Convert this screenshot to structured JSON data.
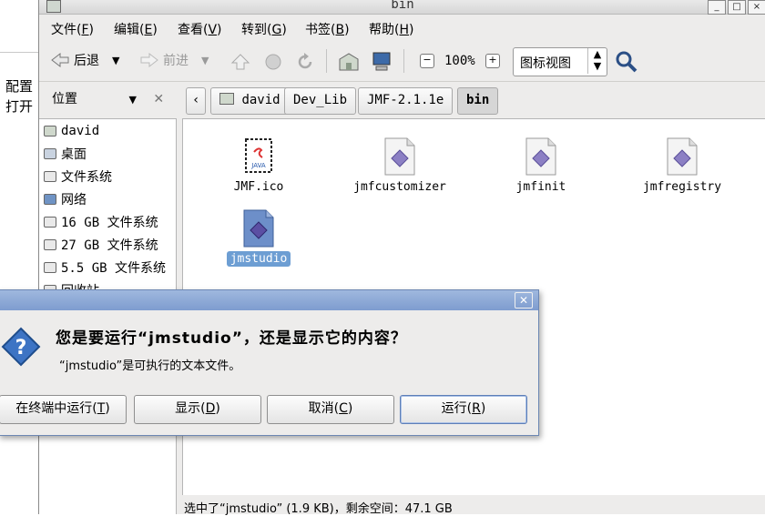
{
  "background_window": {
    "labels": [
      "配置",
      "打开"
    ]
  },
  "window": {
    "title": "bin"
  },
  "menubar": {
    "items": [
      {
        "label": "文件(",
        "key": "F",
        "end": ")"
      },
      {
        "label": "编辑(",
        "key": "E",
        "end": ")"
      },
      {
        "label": "查看(",
        "key": "V",
        "end": ")"
      },
      {
        "label": "转到(",
        "key": "G",
        "end": ")"
      },
      {
        "label": "书签(",
        "key": "B",
        "end": ")"
      },
      {
        "label": "帮助(",
        "key": "H",
        "end": ")"
      }
    ]
  },
  "toolbar": {
    "back_label": "后退",
    "forward_label": "前进",
    "zoom_level": "100%",
    "view_mode": "图标视图"
  },
  "location": {
    "places_label": "位置",
    "crumbs": [
      "david",
      "Dev_Lib",
      "JMF-2.1.1e",
      "bin"
    ]
  },
  "sidebar": {
    "items": [
      "david",
      "桌面",
      "文件系统",
      "网络",
      "16 GB 文件系统",
      "27 GB 文件系统",
      "5.5 GB 文件系统",
      "回收站"
    ]
  },
  "files": [
    {
      "name": "JMF.ico",
      "icon": "java-icon"
    },
    {
      "name": "jmfcustomizer",
      "icon": "executable-icon"
    },
    {
      "name": "jmfinit",
      "icon": "executable-icon"
    },
    {
      "name": "jmfregistry",
      "icon": "executable-icon"
    },
    {
      "name": "jmstudio",
      "icon": "executable-icon",
      "selected": true
    }
  ],
  "status": {
    "text": "选中了“jmstudio” (1.9 KB)，剩余空间：47.1 GB"
  },
  "dialog": {
    "heading": "您是要运行“jmstudio”，还是显示它的内容？",
    "message": "“jmstudio”是可执行的文本文件。",
    "buttons": {
      "terminal": {
        "label": "在终端中运行(",
        "key": "T",
        "end": ")"
      },
      "display": {
        "label": "显示(",
        "key": "D",
        "end": ")"
      },
      "cancel": {
        "label": "取消(",
        "key": "C",
        "end": ")"
      },
      "run": {
        "label": "运行(",
        "key": "R",
        "end": ")"
      }
    }
  },
  "colors": {
    "selection": "#6d9ed3",
    "dialog_title": "#7e9ccf",
    "exec_icon": "#7b6fb8"
  }
}
